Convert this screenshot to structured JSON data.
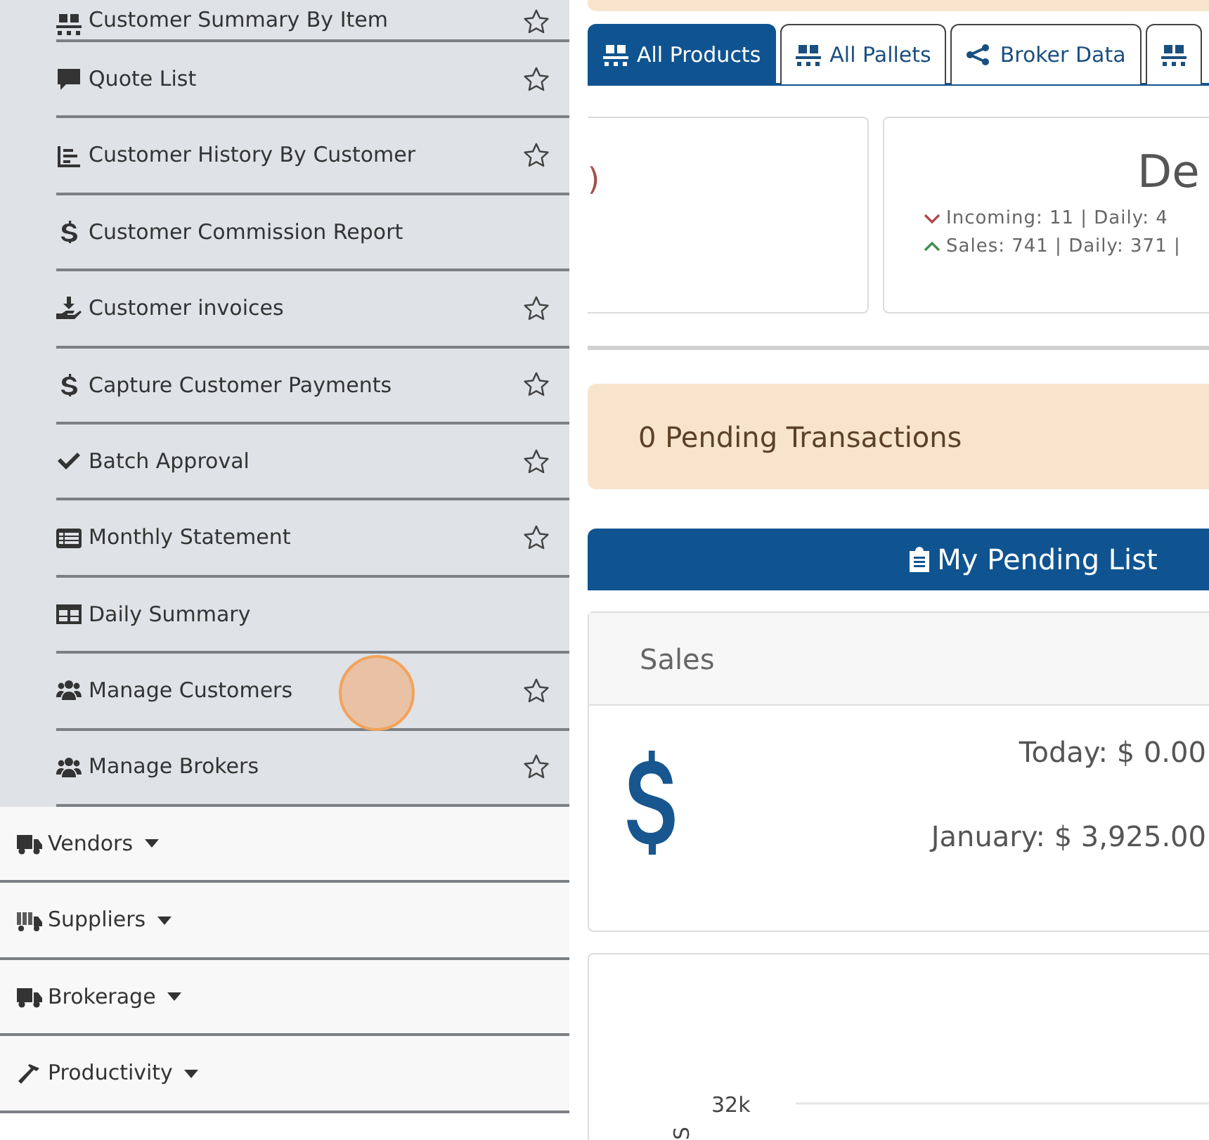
{
  "sidebar": {
    "submenu": [
      {
        "label": "Customer Summary By Item",
        "kind": "pallet",
        "star": true,
        "pointer": false
      },
      {
        "label": "Quote List",
        "kind": "quote",
        "star": true,
        "pointer": false
      },
      {
        "label": "Customer History By Customer",
        "kind": "chart",
        "star": true,
        "pointer": false
      },
      {
        "label": "Customer Commission Report",
        "kind": "dollar",
        "star": false,
        "pointer": false
      },
      {
        "label": "Customer invoices",
        "kind": "hand",
        "star": true,
        "pointer": false
      },
      {
        "label": "Capture Customer Payments",
        "kind": "dollar",
        "star": true,
        "pointer": false
      },
      {
        "label": "Batch Approval",
        "kind": "check",
        "star": true,
        "pointer": false
      },
      {
        "label": "Monthly Statement",
        "kind": "list",
        "star": true,
        "pointer": false
      },
      {
        "label": "Daily Summary",
        "kind": "table",
        "star": false,
        "pointer": false
      },
      {
        "label": "Manage Customers",
        "kind": "users",
        "star": true,
        "pointer": true
      },
      {
        "label": "Manage Brokers",
        "kind": "users",
        "star": true,
        "pointer": false
      }
    ],
    "menus": [
      {
        "label": "Vendors",
        "kind": "truck"
      },
      {
        "label": "Suppliers",
        "kind": "loading"
      },
      {
        "label": "Brokerage",
        "kind": "truck"
      },
      {
        "label": "Productivity",
        "kind": "hammer"
      }
    ]
  },
  "tabs": [
    {
      "label": "All Products",
      "kind": "pallet",
      "selected": true
    },
    {
      "label": "All Pallets",
      "kind": "pallet",
      "selected": false
    },
    {
      "label": "Broker Data",
      "kind": "share",
      "selected": false
    },
    {
      "kind": "pallet",
      "selected": false
    }
  ],
  "stat_cards": [
    {
      "text": ")"
    },
    {
      "title": "De",
      "lines": [
        {
          "kind": "down",
          "text": "Incoming: 11 | Daily: 4"
        },
        {
          "kind": "up",
          "text": "Sales: 741 | Daily: 371 |"
        }
      ]
    }
  ],
  "pending_alert": "0 Pending Transactions",
  "pending_list_button": "My Pending List",
  "sales_card": {
    "title": "Sales",
    "today": "Today: $ 0.00",
    "month": "January: $ 3,925.00"
  },
  "chart": {
    "ytick": "32k",
    "ylabel": "S"
  }
}
